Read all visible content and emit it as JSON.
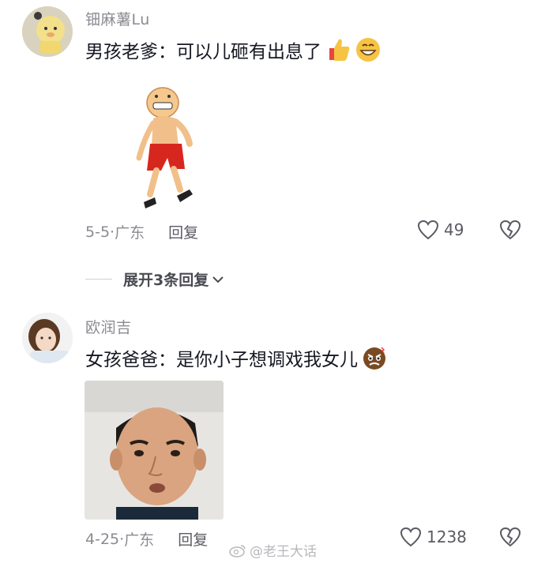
{
  "comments": [
    {
      "username": "钿麻薯Lu",
      "text": "男孩老爹：可以儿砸有出息了",
      "emojis": [
        "thumbs-up-emoji",
        "grinning-face-emoji"
      ],
      "date": "5-5",
      "location": "广东",
      "reply_label": "回复",
      "likes": "49",
      "expand_label": "展开3条回复"
    },
    {
      "username": "欧润吉",
      "text": "女孩爸爸：是你小子想调戏我女儿",
      "emojis": [
        "angry-face-emoji"
      ],
      "date": "4-25",
      "location": "广东",
      "reply_label": "回复",
      "likes": "1238"
    }
  ],
  "watermark": "@老王大话",
  "colors": {
    "text": "#161823",
    "secondary": "#8a8b91",
    "emoji_yellow": "#f6c343"
  }
}
